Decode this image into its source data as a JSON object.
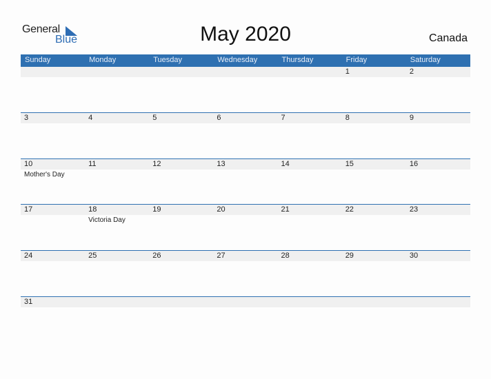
{
  "logo": {
    "general": "General",
    "blue": "Blue"
  },
  "title": "May 2020",
  "country": "Canada",
  "colors": {
    "accent": "#2e70b1",
    "band": "#f0f0f0"
  },
  "weekdays": [
    "Sunday",
    "Monday",
    "Tuesday",
    "Wednesday",
    "Thursday",
    "Friday",
    "Saturday"
  ],
  "weeks": [
    [
      {
        "day": ""
      },
      {
        "day": ""
      },
      {
        "day": ""
      },
      {
        "day": ""
      },
      {
        "day": ""
      },
      {
        "day": "1"
      },
      {
        "day": "2"
      }
    ],
    [
      {
        "day": "3"
      },
      {
        "day": "4"
      },
      {
        "day": "5"
      },
      {
        "day": "6"
      },
      {
        "day": "7"
      },
      {
        "day": "8"
      },
      {
        "day": "9"
      }
    ],
    [
      {
        "day": "10",
        "holiday": "Mother's Day"
      },
      {
        "day": "11"
      },
      {
        "day": "12"
      },
      {
        "day": "13"
      },
      {
        "day": "14"
      },
      {
        "day": "15"
      },
      {
        "day": "16"
      }
    ],
    [
      {
        "day": "17"
      },
      {
        "day": "18",
        "holiday": "Victoria Day"
      },
      {
        "day": "19"
      },
      {
        "day": "20"
      },
      {
        "day": "21"
      },
      {
        "day": "22"
      },
      {
        "day": "23"
      }
    ],
    [
      {
        "day": "24"
      },
      {
        "day": "25"
      },
      {
        "day": "26"
      },
      {
        "day": "27"
      },
      {
        "day": "28"
      },
      {
        "day": "29"
      },
      {
        "day": "30"
      }
    ],
    [
      {
        "day": "31"
      },
      {
        "day": ""
      },
      {
        "day": ""
      },
      {
        "day": ""
      },
      {
        "day": ""
      },
      {
        "day": ""
      },
      {
        "day": ""
      }
    ]
  ]
}
